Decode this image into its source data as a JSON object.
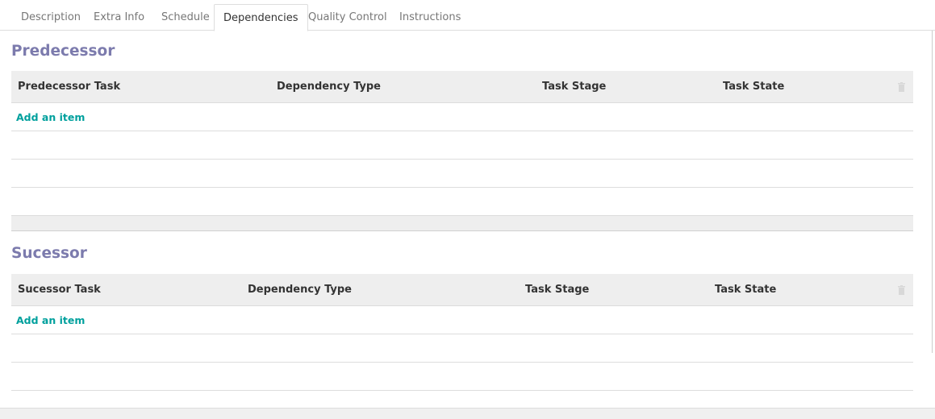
{
  "tabs": [
    {
      "label": "Description"
    },
    {
      "label": "Extra Info"
    },
    {
      "label": "Schedule"
    },
    {
      "label": "Dependencies",
      "active": true
    },
    {
      "label": "Quality Control"
    },
    {
      "label": "Instructions"
    }
  ],
  "predecessor": {
    "title": "Predecessor",
    "columns": [
      "Predecessor Task",
      "Dependency Type",
      "Task Stage",
      "Task State"
    ],
    "add_label": "Add an item",
    "delete_icon": "trash-icon"
  },
  "successor": {
    "title": "Sucessor",
    "columns": [
      "Sucessor Task",
      "Dependency Type",
      "Task Stage",
      "Task State"
    ],
    "add_label": "Add an item",
    "delete_icon": "trash-icon"
  },
  "colors": {
    "section_title": "#7c7bad",
    "link": "#00a09d",
    "header_bg": "#eeeeee"
  }
}
